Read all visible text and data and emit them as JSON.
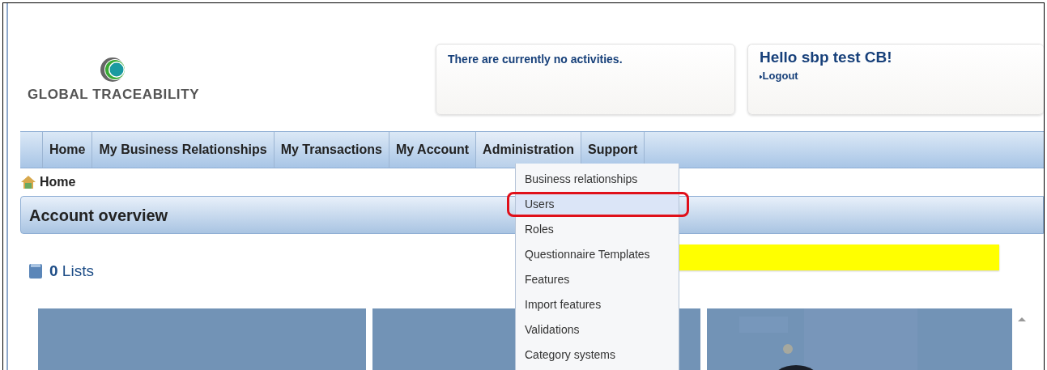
{
  "logo": {
    "text": "GLOBAL TRACEABILITY"
  },
  "activities": {
    "message": "There are currently no activities."
  },
  "user_box": {
    "greeting": "Hello sbp test CB!",
    "logout": "Logout"
  },
  "nav": [
    {
      "label": "Home",
      "expanded": false
    },
    {
      "label": "My Business Relationships",
      "expanded": false
    },
    {
      "label": "My Transactions",
      "expanded": false
    },
    {
      "label": "My Account",
      "expanded": false
    },
    {
      "label": "Administration",
      "expanded": true
    },
    {
      "label": "Support",
      "expanded": false
    }
  ],
  "dropdown": [
    {
      "label": "Business relationships",
      "selected": false,
      "highlighted": false
    },
    {
      "label": "Users",
      "selected": true,
      "highlighted": true
    },
    {
      "label": "Roles",
      "selected": false,
      "highlighted": false
    },
    {
      "label": "Questionnaire Templates",
      "selected": false,
      "highlighted": false
    },
    {
      "label": "Features",
      "selected": false,
      "highlighted": false
    },
    {
      "label": "Import features",
      "selected": false,
      "highlighted": false
    },
    {
      "label": "Validations",
      "selected": false,
      "highlighted": false
    },
    {
      "label": "Category systems",
      "selected": false,
      "highlighted": false
    }
  ],
  "breadcrumb": "Home",
  "section_title": "Account overview",
  "lists": {
    "count": "0",
    "label": "Lists"
  },
  "tiles": [
    {
      "kind": "plain"
    },
    {
      "kind": "plain"
    },
    {
      "kind": "picture"
    }
  ]
}
